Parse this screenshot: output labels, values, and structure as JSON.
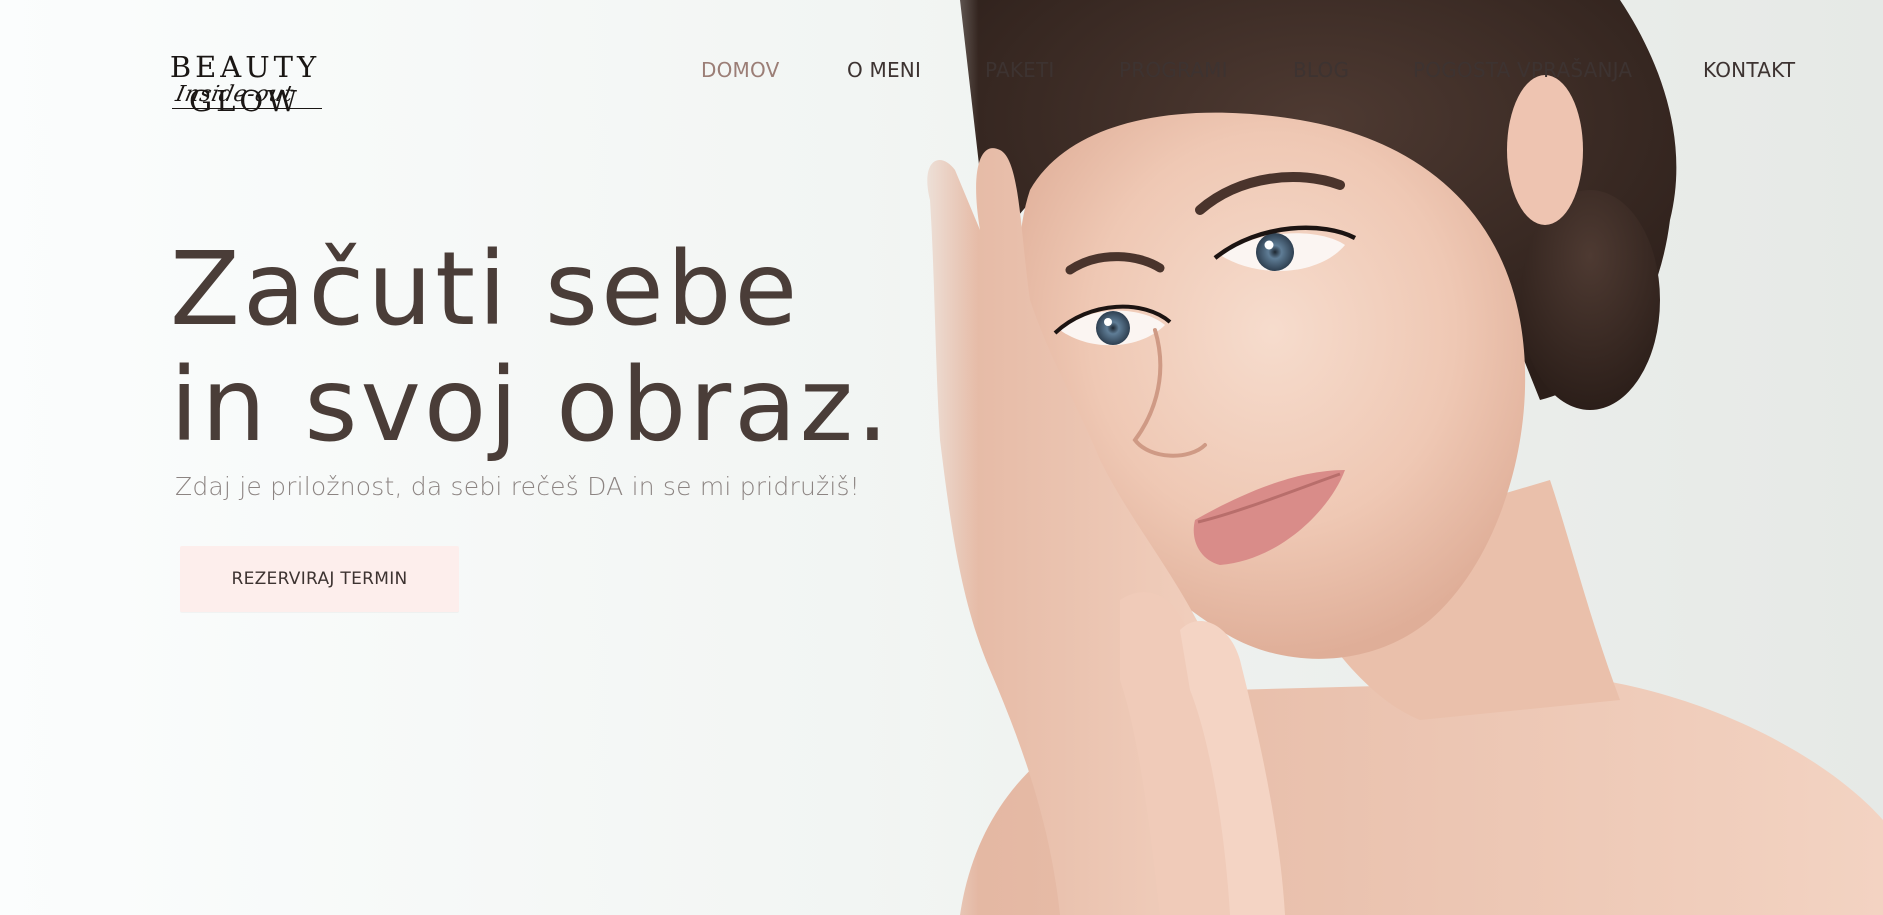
{
  "logo": {
    "name": "BEAUTY GLOW",
    "tagline": "Inside-out"
  },
  "nav": {
    "items": [
      {
        "label": "DOMOV",
        "active": true
      },
      {
        "label": "O MENI",
        "active": false
      },
      {
        "label": "PAKETI",
        "active": false
      },
      {
        "label": "PROGRAMI",
        "active": false
      },
      {
        "label": "BLOG",
        "active": false
      },
      {
        "label": "POGOSTA VPRAŠANJA",
        "active": false
      },
      {
        "label": "KONTAKT",
        "active": false
      }
    ]
  },
  "hero": {
    "title_line1": "Začuti sebe",
    "title_line2": "in svoj obraz.",
    "subtitle": "Zdaj je priložnost, da sebi rečeš DA in se mi pridružiš!",
    "cta_label": "REZERVIRAJ TERMIN"
  },
  "colors": {
    "heading": "#4a3d38",
    "nav_text": "#3d3331",
    "nav_active": "#9b7e76",
    "subtitle": "#8c8482",
    "cta_background": "#fdeeec",
    "background": "#f2f5f3"
  }
}
